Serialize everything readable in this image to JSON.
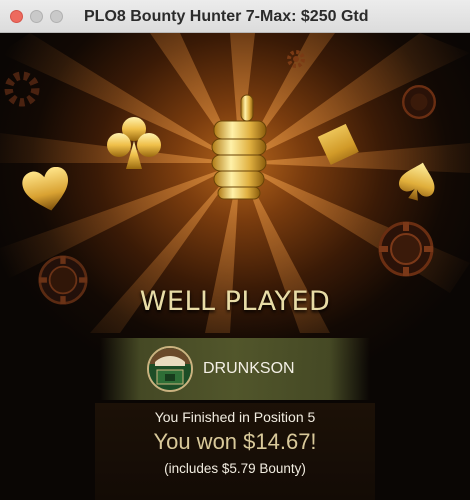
{
  "window": {
    "title": "PLO8 Bounty Hunter 7-Max: $250 Gtd",
    "controls": [
      "close",
      "minimize",
      "maximize"
    ]
  },
  "banner": {
    "icons": [
      "thumbs-up-trophy-icon",
      "club-icon",
      "diamond-icon",
      "heart-icon",
      "spade-icon",
      "poker-chip-icon"
    ],
    "title": "WELL PLAYED"
  },
  "player": {
    "avatar": "avatar-icon",
    "name": "DRUNKSON"
  },
  "result": {
    "finish": "You Finished in Position 5",
    "won": "You won $14.67!",
    "bounty": "(includes $5.79 Bounty)"
  },
  "colors": {
    "accent_gold": "#e8dca6",
    "glow": "#b5651c",
    "player_bar": "#55592d"
  }
}
